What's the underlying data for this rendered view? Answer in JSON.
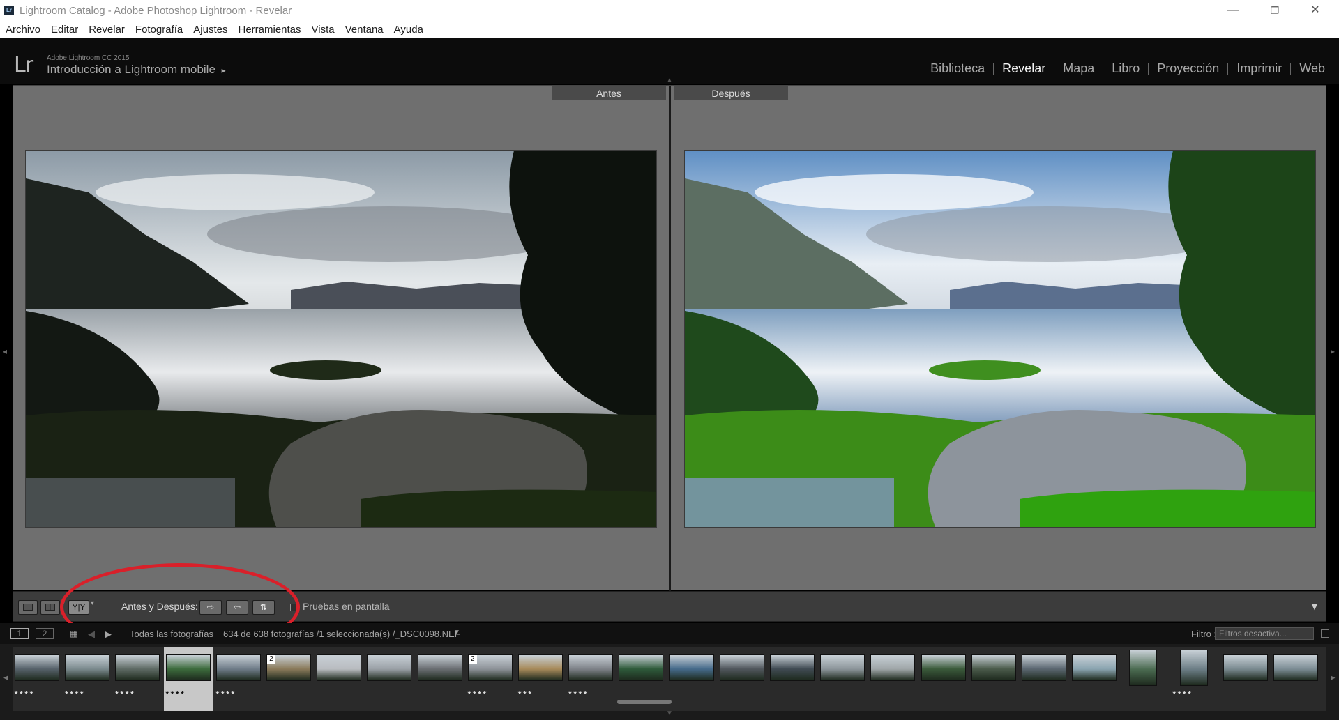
{
  "window": {
    "title": "Lightroom Catalog - Adobe Photoshop Lightroom - Revelar",
    "minimize": "—",
    "restore": "❐",
    "close": "✕",
    "app_icon_letters": "Lr"
  },
  "menu": [
    "Archivo",
    "Editar",
    "Revelar",
    "Fotografía",
    "Ajustes",
    "Herramientas",
    "Vista",
    "Ventana",
    "Ayuda"
  ],
  "identity": {
    "logo": "Lr",
    "product": "Adobe Lightroom CC 2015",
    "plate": "Introducción a Lightroom mobile",
    "arrow": "▸"
  },
  "modules": [
    "Biblioteca",
    "Revelar",
    "Mapa",
    "Libro",
    "Proyección",
    "Imprimir",
    "Web"
  ],
  "active_module": "Revelar",
  "view": {
    "before_label": "Antes",
    "after_label": "Después"
  },
  "toolbar": {
    "compare_label": "Antes y Después:",
    "softproof_label": "Pruebas en pantalla",
    "yy": "Y|Y"
  },
  "filmstrip_bar": {
    "page1": "1",
    "page2": "2",
    "source": "Todas las fotografías",
    "count": "634 de 638 fotografías /1 seleccionada(s) /_DSC0098.NEF",
    "filter_label": "Filtro :",
    "filter_value": "Filtros desactiva..."
  },
  "thumbnails": [
    {
      "stars": "★★★★",
      "badge": ""
    },
    {
      "stars": "★★★★",
      "badge": ""
    },
    {
      "stars": "★★★★",
      "badge": ""
    },
    {
      "stars": "★★★★",
      "badge": "",
      "selected": true
    },
    {
      "stars": "★★★★",
      "badge": ""
    },
    {
      "stars": "",
      "badge": "2"
    },
    {
      "stars": "",
      "badge": ""
    },
    {
      "stars": "",
      "badge": ""
    },
    {
      "stars": "",
      "badge": ""
    },
    {
      "stars": "★★★★",
      "badge": "2"
    },
    {
      "stars": "★★★",
      "badge": ""
    },
    {
      "stars": "★★★★",
      "badge": ""
    },
    {
      "stars": "",
      "badge": ""
    },
    {
      "stars": "",
      "badge": ""
    },
    {
      "stars": "",
      "badge": ""
    },
    {
      "stars": "",
      "badge": ""
    },
    {
      "stars": "",
      "badge": ""
    },
    {
      "stars": "",
      "badge": ""
    },
    {
      "stars": "",
      "badge": ""
    },
    {
      "stars": "",
      "badge": ""
    },
    {
      "stars": "",
      "badge": ""
    },
    {
      "stars": "",
      "badge": ""
    },
    {
      "stars": "",
      "badge": ""
    },
    {
      "stars": "★★★★",
      "badge": ""
    },
    {
      "stars": "",
      "badge": ""
    },
    {
      "stars": "",
      "badge": ""
    }
  ],
  "colors": {
    "annotation_circle": "#d9202a",
    "workspace_bg": "#6f6f6f",
    "panel_bg": "#0c0c0c"
  },
  "icons": [
    "single-view-icon",
    "grid-view-icon",
    "swap-before-after-icon",
    "copy-before-to-after-icon",
    "copy-after-to-before-icon",
    "toggle-view-icon",
    "grid-icon",
    "back-arrow-icon",
    "forward-arrow-icon",
    "chevron-down-icon"
  ]
}
